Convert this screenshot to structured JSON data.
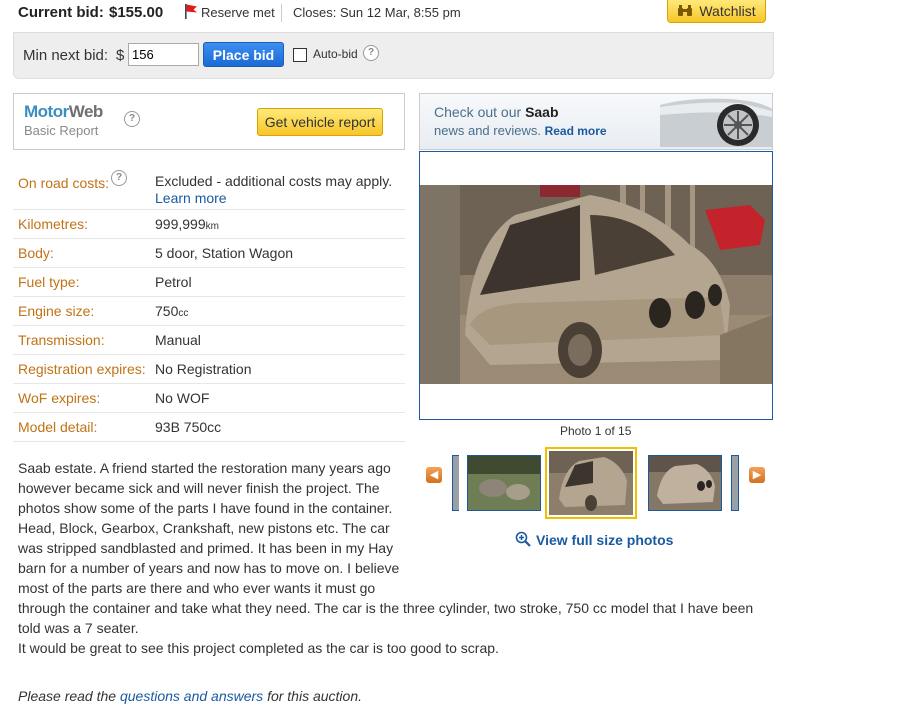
{
  "header": {
    "current_bid_label": "Current bid:",
    "current_bid_value": "$155.00",
    "reserve_text": "Reserve met",
    "closes_text": "Closes: Sun 12 Mar, 8:55 pm",
    "watchlist_label": "Watchlist"
  },
  "bid": {
    "min_next_label": "Min next bid:",
    "currency": "$",
    "amount": "156",
    "place_bid_label": "Place bid",
    "autobid_label": "Auto-bid",
    "help_glyph": "?"
  },
  "motorweb": {
    "logo_motor": "Motor",
    "logo_web": "Web",
    "logo_sub": "Basic Report",
    "report_button": "Get vehicle report"
  },
  "banner": {
    "prefix": "Check out our",
    "brand": "Saab",
    "line2": "news and reviews.",
    "read_more": "Read more"
  },
  "specs": [
    {
      "label": "On road costs:",
      "value": "Excluded - additional costs may apply.",
      "link": "Learn more"
    },
    {
      "label": "Kilometres:",
      "value": "999,999",
      "unit": "km"
    },
    {
      "label": "Body:",
      "value": "5 door, Station Wagon"
    },
    {
      "label": "Fuel type:",
      "value": "Petrol"
    },
    {
      "label": "Engine size:",
      "value": "750",
      "unit": "cc"
    },
    {
      "label": "Transmission:",
      "value": "Manual"
    },
    {
      "label": "Registration expires:",
      "value": "No Registration"
    },
    {
      "label": "WoF expires:",
      "value": "No WOF"
    },
    {
      "label": "Model detail:",
      "value": "93B 750cc"
    }
  ],
  "photo": {
    "counter": "Photo 1 of 15",
    "full_size_link": "View full size photos",
    "prev_glyph": "◀",
    "next_glyph": "▶"
  },
  "description": {
    "narrow": "Saab estate. A friend started the restoration many years ago however became sick and will never finish the project. The photos show some of the parts I have found in the container. Head, Block, Gearbox, Crankshaft, new pistons etc. The car was stripped sandblasted and primed. It has been in my Hay barn for a number of years and now has to move on. I believe most of the parts are there and who ever wants it must go",
    "wide": "through the container and take what they need. The car is the three cylinder, two stroke, 750 cc model that I have been told was a 7 seater.",
    "last": "It would be great to see this project completed as the car is too good to scrap.",
    "qa_prefix": "Please read the",
    "qa_link": "questions and answers",
    "qa_suffix": "for this auction."
  },
  "colors": {
    "label_orange": "#c07317",
    "link_blue": "#1a5aa0",
    "button_yellow": "#f7c62a",
    "button_blue": "#1b6ad6"
  }
}
